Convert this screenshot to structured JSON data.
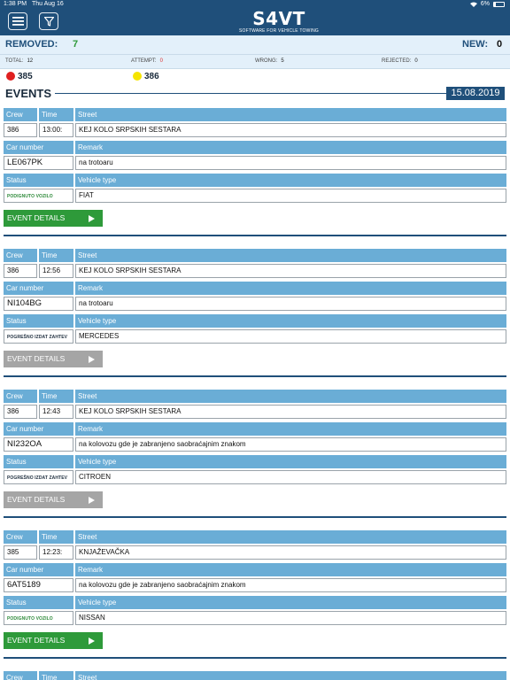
{
  "status_bar": {
    "time": "1:38 PM",
    "date": "Thu Aug 16",
    "battery": "6%"
  },
  "header": {
    "menu_icon": "hamburger-menu-icon",
    "filter_icon": "filter-funnel-icon",
    "logo_text": "S4VT",
    "logo_subtitle": "SOFTWARE FOR VEHICLE TOWING"
  },
  "summary": {
    "removed_label": "REMOVED:",
    "removed_value": "7",
    "new_label": "NEW:",
    "new_value": "0",
    "total_label": "TOTAL:",
    "total_value": "12",
    "attempt_label": "ATTEMPT:",
    "attempt_value": "0",
    "wrong_label": "WRONG:",
    "wrong_value": "5",
    "rejected_label": "REJECTED:",
    "rejected_value": "0"
  },
  "crews": [
    {
      "number": "385",
      "color": "#e02020"
    },
    {
      "number": "386",
      "color": "#f5e400"
    }
  ],
  "events_header": {
    "title": "EVENTS",
    "date": "15.08.2019"
  },
  "labels": {
    "crew": "Crew",
    "time": "Time",
    "street": "Street",
    "car_number": "Car number",
    "remark": "Remark",
    "status": "Status",
    "vehicle_type": "Vehicle type",
    "event_details": "EVENT DETAILS"
  },
  "events": [
    {
      "crew": "386",
      "time": "13:00:",
      "street": "KEJ KOLO SRPSKIH SESTARA",
      "car_number": "LE067PK",
      "remark": "na trotoaru",
      "status": "PODIGNUTO VOZILO",
      "vehicle_type": "FIAT",
      "details_enabled": true
    },
    {
      "crew": "386",
      "time": "12:56",
      "street": "KEJ KOLO SRPSKIH SESTARA",
      "car_number": "NI104BG",
      "remark": "na trotoaru",
      "status": "POGREŠNO IZDAT ZAHTEV",
      "vehicle_type": "MERCEDES",
      "details_enabled": false
    },
    {
      "crew": "386",
      "time": "12:43",
      "street": "KEJ KOLO SRPSKIH SESTARA",
      "car_number": "NI232OA",
      "remark": "na kolovozu gde je zabranjeno saobraćajnim znakom",
      "status": "POGREŠNO IZDAT ZAHTEV",
      "vehicle_type": "CITROEN",
      "details_enabled": false
    },
    {
      "crew": "385",
      "time": "12:23:",
      "street": "KNJAŽEVAČKA",
      "car_number": "6AT5189",
      "remark": "na kolovozu gde je zabranjeno saobraćajnim znakom",
      "status": "PODIGNUTO VOZILO",
      "vehicle_type": "NISSAN",
      "details_enabled": true
    }
  ],
  "colors": {
    "header_bg": "#1f4f7a",
    "cell_header_bg": "#6aadd6",
    "details_enabled": "#2e9a3a",
    "details_disabled": "#a5a5a5",
    "removed_value": "#2e9a3a"
  }
}
